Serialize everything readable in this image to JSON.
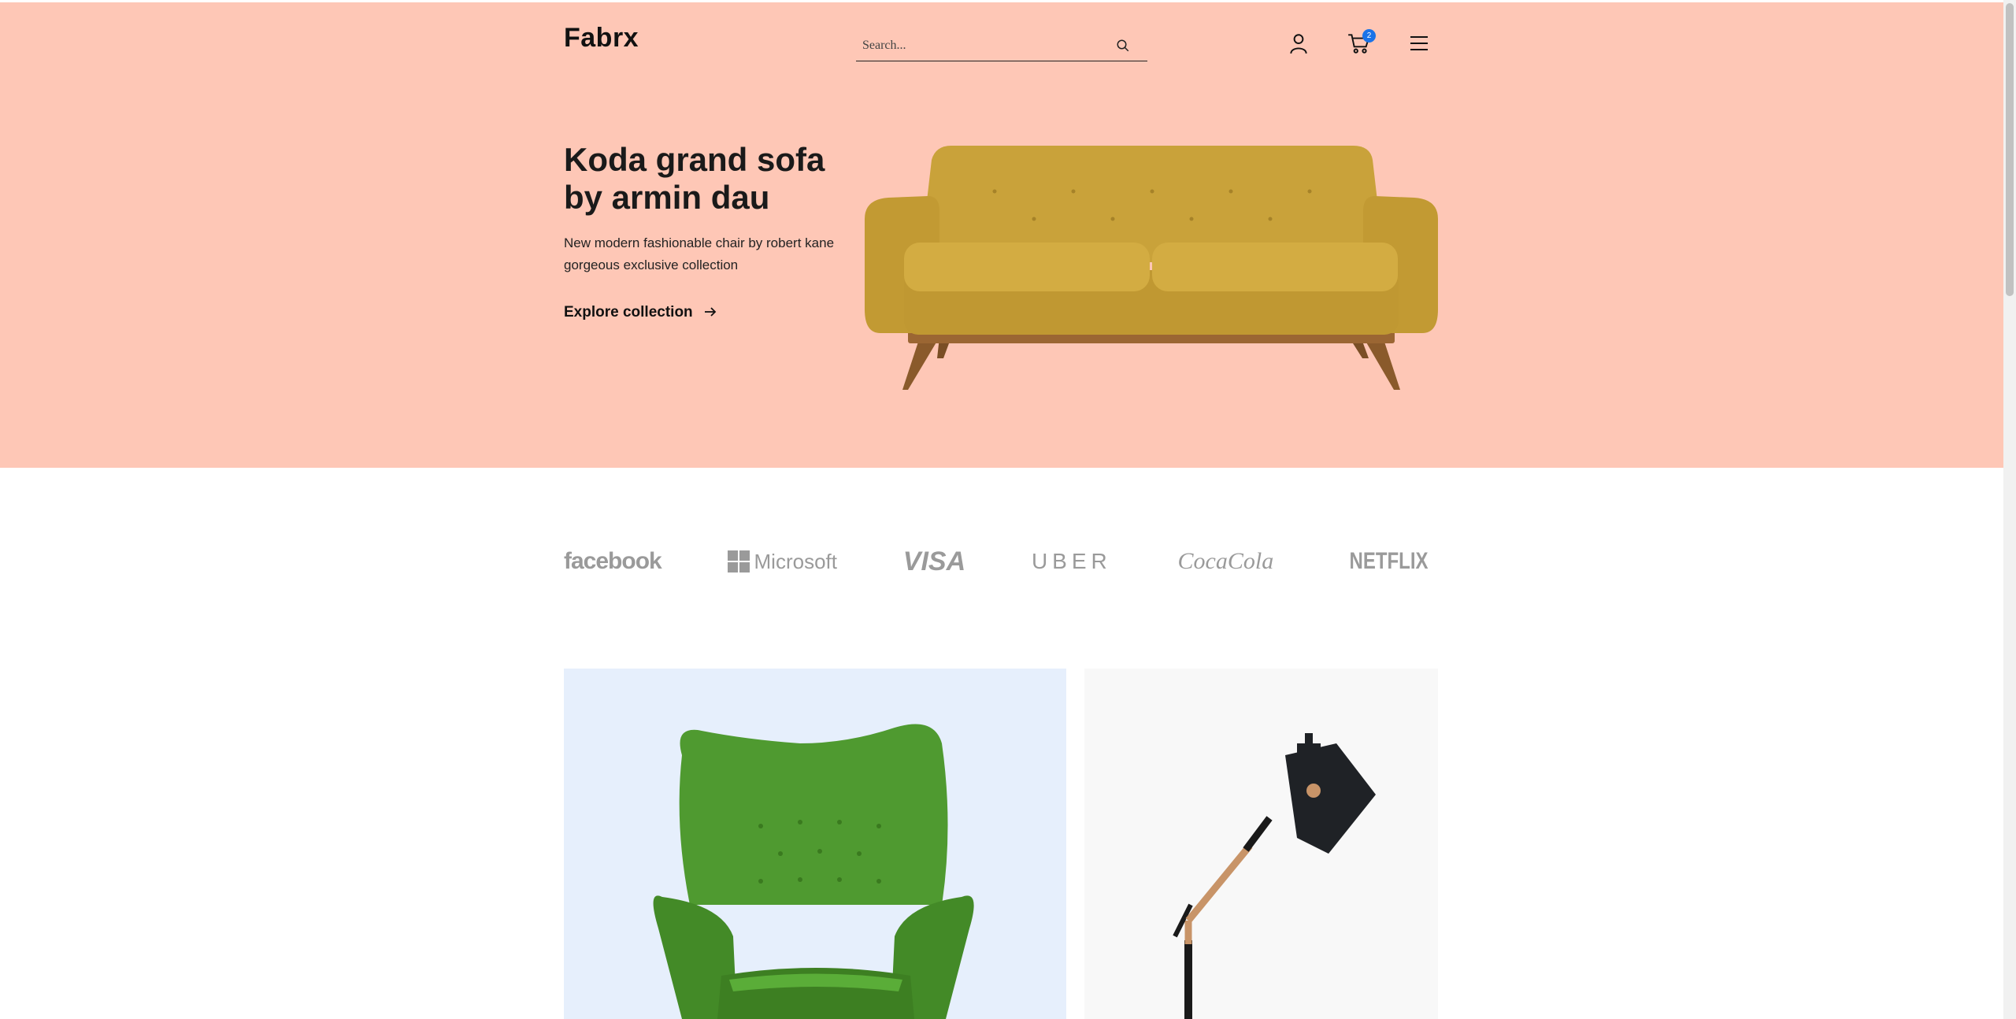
{
  "header": {
    "logo": "Fabrx",
    "search_placeholder": "Search...",
    "cart_count": "2"
  },
  "hero": {
    "title": "Koda grand sofa by armin dau",
    "description": "New modern fashionable chair by robert kane gorgeous exclusive collection",
    "link_label": "Explore collection"
  },
  "brands": [
    "facebook",
    "Microsoft",
    "VISA",
    "UBER",
    "CocaCola",
    "NETFLIX"
  ],
  "colors": {
    "hero_bg": "#fec7b6",
    "chair_card_bg": "#e6effc",
    "lamp_card_bg": "#f8f8f8",
    "badge": "#1a73e8",
    "sofa": "#c9a23a",
    "chair": "#4f9a30"
  },
  "icons": [
    "search-icon",
    "user-icon",
    "cart-icon",
    "menu-icon",
    "arrow-right-icon"
  ]
}
